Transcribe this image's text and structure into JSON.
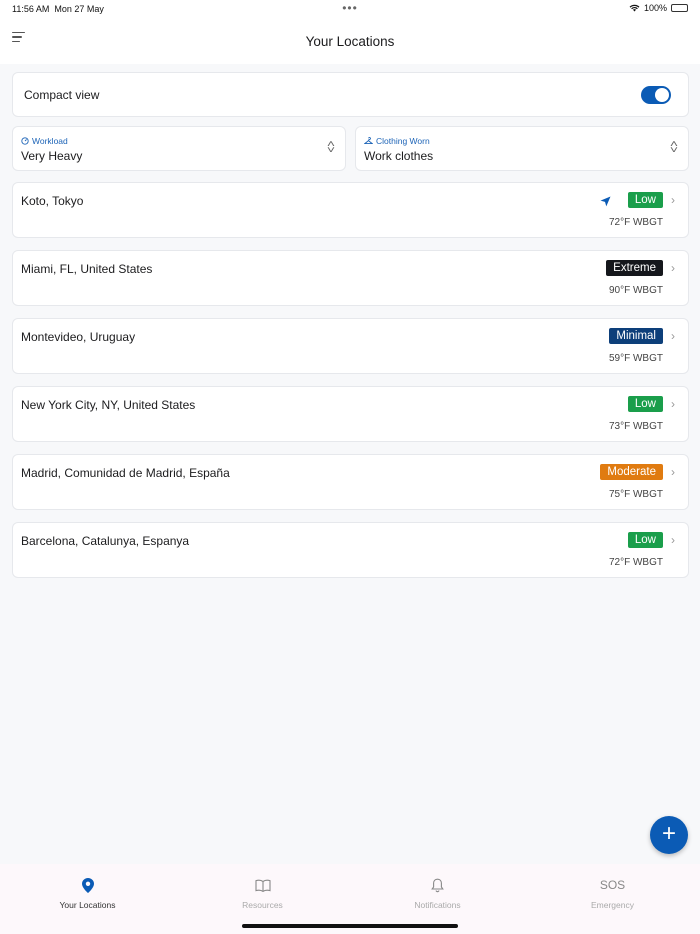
{
  "status": {
    "time": "11:56 AM",
    "date": "Mon 27 May",
    "battery": "100%"
  },
  "header": {
    "title": "Your Locations"
  },
  "compact": {
    "label": "Compact view",
    "enabled": true
  },
  "selectors": {
    "workload": {
      "caption": "Workload",
      "value": "Very Heavy"
    },
    "clothing": {
      "caption": "Clothing Worn",
      "value": "Work clothes"
    }
  },
  "locations": [
    {
      "name": "Koto, Tokyo",
      "risk": "Low",
      "temp": "72°F WBGT",
      "color": "#1a9e4b",
      "current": true
    },
    {
      "name": "Miami, FL, United States",
      "risk": "Extreme",
      "temp": "90°F WBGT",
      "color": "#15171c"
    },
    {
      "name": "Montevideo, Uruguay",
      "risk": "Minimal",
      "temp": "59°F WBGT",
      "color": "#0d3f7a"
    },
    {
      "name": "New York City, NY, United States",
      "risk": "Low",
      "temp": "73°F WBGT",
      "color": "#1a9e4b"
    },
    {
      "name": "Madrid, Comunidad de Madrid, España",
      "risk": "Moderate",
      "temp": "75°F WBGT",
      "color": "#e07b10"
    },
    {
      "name": "Barcelona, Catalunya, Espanya",
      "risk": "Low",
      "temp": "72°F WBGT",
      "color": "#1a9e4b"
    }
  ],
  "fab": {
    "icon": "plus-icon"
  },
  "tabs": [
    {
      "label": "Your Locations",
      "icon": "location-pin-icon",
      "active": true
    },
    {
      "label": "Resources",
      "icon": "book-icon"
    },
    {
      "label": "Notifications",
      "icon": "bell-icon"
    },
    {
      "label": "Emergency",
      "icon": "sos-icon",
      "text": "SOS"
    }
  ],
  "accent": "#0b5bb5"
}
